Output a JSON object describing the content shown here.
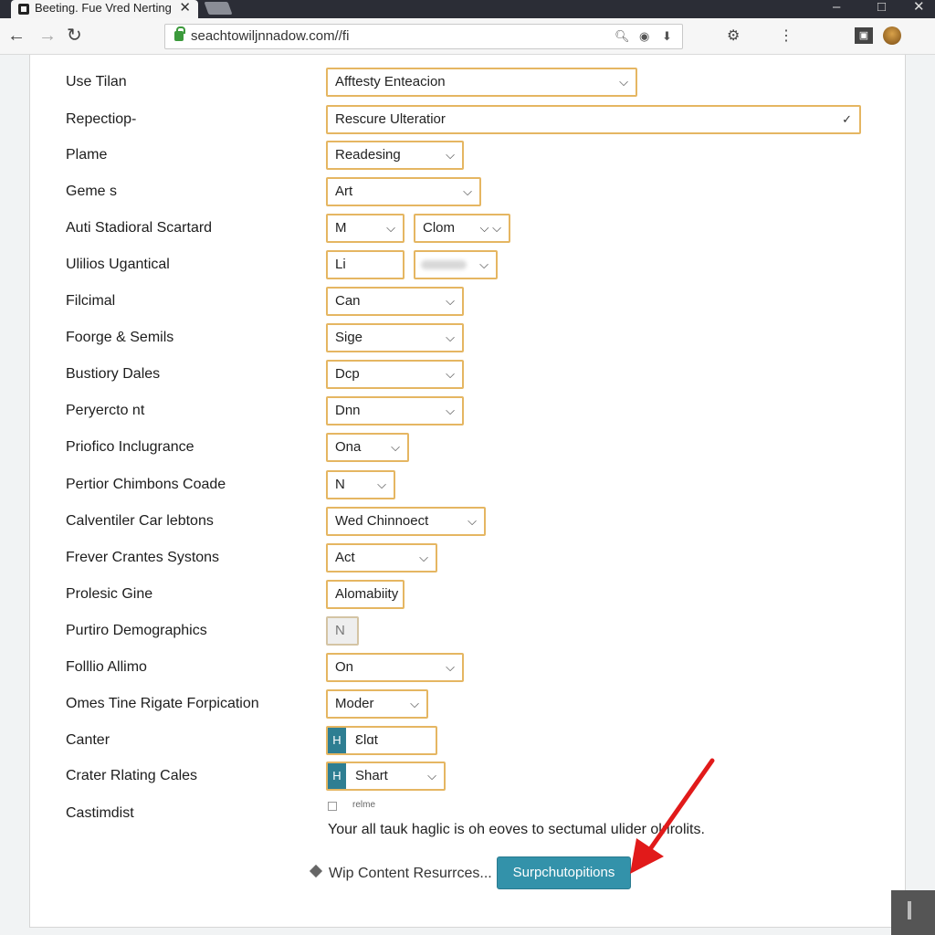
{
  "browser": {
    "tab_title": "Beeting. Fue Vred Nerting",
    "tab_close": "✕",
    "url": "seachtowiljnnadow.com//fi",
    "win_min": "–",
    "win_max": "□",
    "win_close": "✕",
    "nav_back": "←",
    "nav_forward": "→",
    "nav_reload": "↻"
  },
  "form": {
    "rows": [
      {
        "label": "Use Tilan",
        "value": "Afftesty Enteacion"
      },
      {
        "label": "Repectiop-",
        "value": "Rescure Ulteratior"
      },
      {
        "label": "Plame",
        "value": "Readesing"
      },
      {
        "label": "Geme s",
        "value": "Art"
      },
      {
        "label": "Auti Stadioral Scartard",
        "value": "M",
        "value2": "Clom"
      },
      {
        "label": "Ulilios Ugantical",
        "value": "Li"
      },
      {
        "label": "Filcimal",
        "value": "Can"
      },
      {
        "label": "Foorge & Semils",
        "value": "Sige"
      },
      {
        "label": "Bustiory Dales",
        "value": "Dcp"
      },
      {
        "label": "Peryercto nt",
        "value": "Dnn"
      },
      {
        "label": "Prioﬁco Inclugrance",
        "value": "Ona"
      },
      {
        "label": "Pertior Chimbons Coade",
        "value": "N"
      },
      {
        "label": "Calventiler Car lebtons",
        "value": "Wed Chinnoect"
      },
      {
        "label": "Frever Crantes Systons",
        "value": "Act"
      },
      {
        "label": "Prolesic Gine",
        "value": "Alomabiity"
      },
      {
        "label": "Purtiro Demographics",
        "value": "N"
      },
      {
        "label": "Folllio Allimo",
        "value": "On"
      },
      {
        "label": "Omes Tine Rigate Forpication",
        "value": "Moder"
      },
      {
        "label": "Canter",
        "badge": "H",
        "value": "Ɛlɑt"
      },
      {
        "label": "Crater Rlating Cales",
        "badge": "H",
        "value": "Shart"
      },
      {
        "label": "Castimdist"
      }
    ],
    "checkbox_label": "relme",
    "notice": "Your all tauk haglic is oh eoves to sectumal ulider olrirolits.",
    "link_text": "Wip Content Resurrces...",
    "submit_label": "Surpchutopitions"
  },
  "icons": {
    "chevron": "chevron-down-icon",
    "check": "checkmark-icon"
  }
}
